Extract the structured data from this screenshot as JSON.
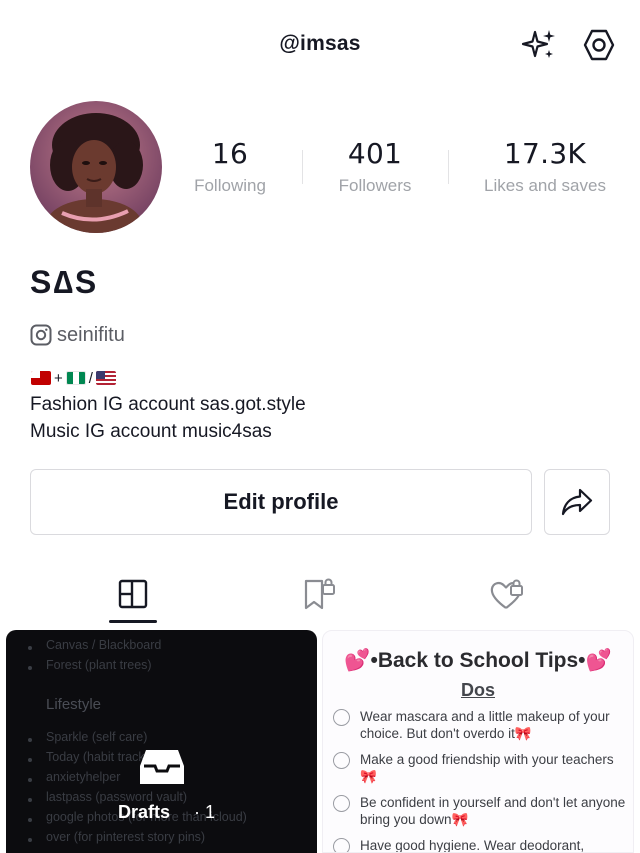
{
  "header": {
    "username": "@imsas",
    "sparkle_icon": "sparkle-icon",
    "settings_icon": "hexagon-settings-icon"
  },
  "profile": {
    "display_name": "S∆S",
    "instagram_handle": "seinifitu",
    "flags_separator_plus": "+",
    "flags_separator_slash": "/",
    "bio_line_1": "Fashion IG account sas.got.style",
    "bio_line_2": "Music IG account music4sas"
  },
  "stats": [
    {
      "value": "16",
      "label": "Following"
    },
    {
      "value": "401",
      "label": "Followers"
    },
    {
      "value": "17.3K",
      "label": "Likes and saves"
    }
  ],
  "actions": {
    "edit_profile": "Edit profile",
    "share_icon": "share-arrow-icon"
  },
  "tabs": [
    {
      "icon": "grid-icon",
      "active": true
    },
    {
      "icon": "saved-lock-icon",
      "active": false
    },
    {
      "icon": "liked-lock-icon",
      "active": false
    }
  ],
  "drafts_tile": {
    "label": "Drafts",
    "count": "· 1",
    "bg_lines": [
      "Canvas / Blackboard",
      "Forest (plant trees)",
      "Lifestyle",
      "Sparkle (self care)",
      "Today (habit tracker)",
      "anxietyhelper",
      "lastpass (password vault)",
      "google photos (for more than icloud)",
      "over (for pinterest story pins)"
    ]
  },
  "tips_tile": {
    "title": "•Back to School Tips•",
    "subtitle": "Dos",
    "items": [
      "Wear mascara and a little makeup of your choice. But don't overdo it",
      "Make a good friendship with your teachers",
      "Be confident in yourself and don't let anyone bring you down",
      "Have good hygiene. Wear deodorant,"
    ]
  },
  "colors": {
    "text_primary": "#161823",
    "text_secondary": "#a0a3a8",
    "border": "#dadade",
    "heart_pink": "#e0489a"
  }
}
